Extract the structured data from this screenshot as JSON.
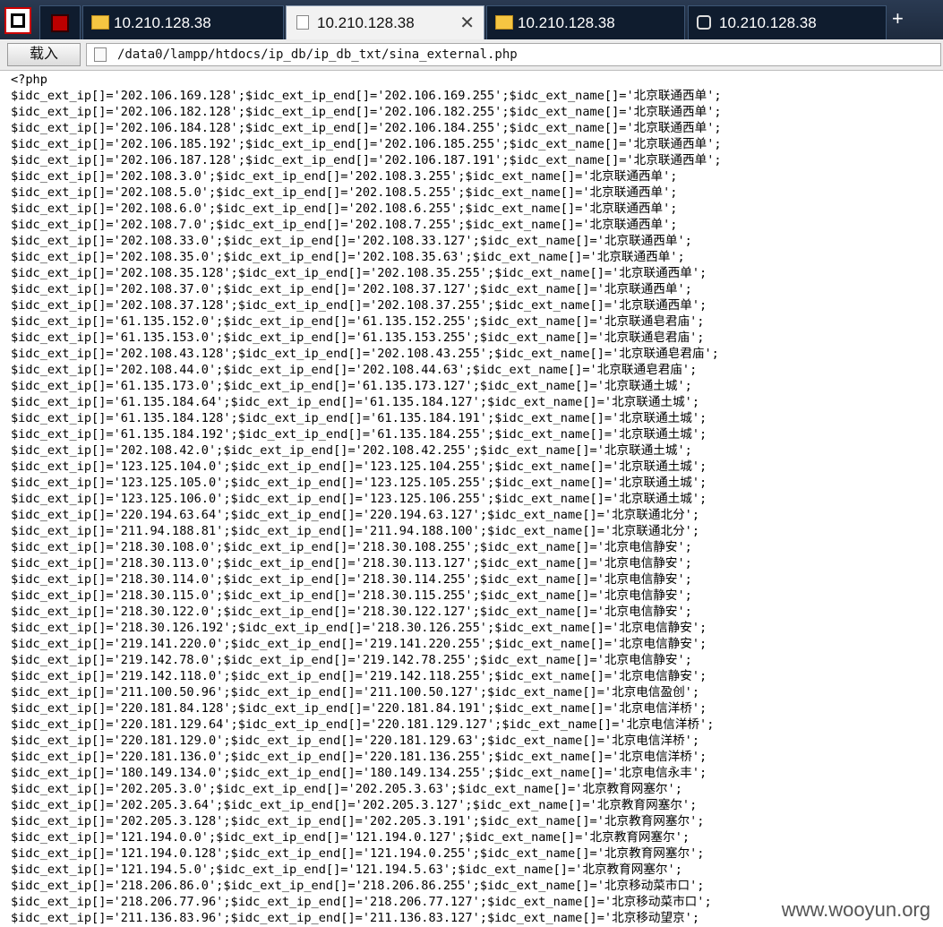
{
  "tabs": [
    {
      "label": "",
      "icon": "red-square-icon"
    },
    {
      "label": "10.210.128.38",
      "icon": "folder-icon"
    },
    {
      "label": "10.210.128.38",
      "icon": "page-icon",
      "active": true
    },
    {
      "label": "10.210.128.38",
      "icon": "folder-icon"
    },
    {
      "label": "10.210.128.38",
      "icon": "database-icon"
    }
  ],
  "tab_close": "✕",
  "new_tab": "+",
  "toolbar": {
    "load_label": "载入",
    "path": "/data0/lampp/htdocs/ip_db/ip_db_txt/sina_external.php"
  },
  "code_lines": [
    "<?php",
    "$idc_ext_ip[]='202.106.169.128';$idc_ext_ip_end[]='202.106.169.255';$idc_ext_name[]='北京联通西单';",
    "$idc_ext_ip[]='202.106.182.128';$idc_ext_ip_end[]='202.106.182.255';$idc_ext_name[]='北京联通西单';",
    "$idc_ext_ip[]='202.106.184.128';$idc_ext_ip_end[]='202.106.184.255';$idc_ext_name[]='北京联通西单';",
    "$idc_ext_ip[]='202.106.185.192';$idc_ext_ip_end[]='202.106.185.255';$idc_ext_name[]='北京联通西单';",
    "$idc_ext_ip[]='202.106.187.128';$idc_ext_ip_end[]='202.106.187.191';$idc_ext_name[]='北京联通西单';",
    "$idc_ext_ip[]='202.108.3.0';$idc_ext_ip_end[]='202.108.3.255';$idc_ext_name[]='北京联通西单';",
    "$idc_ext_ip[]='202.108.5.0';$idc_ext_ip_end[]='202.108.5.255';$idc_ext_name[]='北京联通西单';",
    "$idc_ext_ip[]='202.108.6.0';$idc_ext_ip_end[]='202.108.6.255';$idc_ext_name[]='北京联通西单';",
    "$idc_ext_ip[]='202.108.7.0';$idc_ext_ip_end[]='202.108.7.255';$idc_ext_name[]='北京联通西单';",
    "$idc_ext_ip[]='202.108.33.0';$idc_ext_ip_end[]='202.108.33.127';$idc_ext_name[]='北京联通西单';",
    "$idc_ext_ip[]='202.108.35.0';$idc_ext_ip_end[]='202.108.35.63';$idc_ext_name[]='北京联通西单';",
    "$idc_ext_ip[]='202.108.35.128';$idc_ext_ip_end[]='202.108.35.255';$idc_ext_name[]='北京联通西单';",
    "$idc_ext_ip[]='202.108.37.0';$idc_ext_ip_end[]='202.108.37.127';$idc_ext_name[]='北京联通西单';",
    "$idc_ext_ip[]='202.108.37.128';$idc_ext_ip_end[]='202.108.37.255';$idc_ext_name[]='北京联通西单';",
    "$idc_ext_ip[]='61.135.152.0';$idc_ext_ip_end[]='61.135.152.255';$idc_ext_name[]='北京联通皂君庙';",
    "$idc_ext_ip[]='61.135.153.0';$idc_ext_ip_end[]='61.135.153.255';$idc_ext_name[]='北京联通皂君庙';",
    "$idc_ext_ip[]='202.108.43.128';$idc_ext_ip_end[]='202.108.43.255';$idc_ext_name[]='北京联通皂君庙';",
    "$idc_ext_ip[]='202.108.44.0';$idc_ext_ip_end[]='202.108.44.63';$idc_ext_name[]='北京联通皂君庙';",
    "$idc_ext_ip[]='61.135.173.0';$idc_ext_ip_end[]='61.135.173.127';$idc_ext_name[]='北京联通土城';",
    "$idc_ext_ip[]='61.135.184.64';$idc_ext_ip_end[]='61.135.184.127';$idc_ext_name[]='北京联通土城';",
    "$idc_ext_ip[]='61.135.184.128';$idc_ext_ip_end[]='61.135.184.191';$idc_ext_name[]='北京联通土城';",
    "$idc_ext_ip[]='61.135.184.192';$idc_ext_ip_end[]='61.135.184.255';$idc_ext_name[]='北京联通土城';",
    "$idc_ext_ip[]='202.108.42.0';$idc_ext_ip_end[]='202.108.42.255';$idc_ext_name[]='北京联通土城';",
    "$idc_ext_ip[]='123.125.104.0';$idc_ext_ip_end[]='123.125.104.255';$idc_ext_name[]='北京联通土城';",
    "$idc_ext_ip[]='123.125.105.0';$idc_ext_ip_end[]='123.125.105.255';$idc_ext_name[]='北京联通土城';",
    "$idc_ext_ip[]='123.125.106.0';$idc_ext_ip_end[]='123.125.106.255';$idc_ext_name[]='北京联通土城';",
    "$idc_ext_ip[]='220.194.63.64';$idc_ext_ip_end[]='220.194.63.127';$idc_ext_name[]='北京联通北分';",
    "$idc_ext_ip[]='211.94.188.81';$idc_ext_ip_end[]='211.94.188.100';$idc_ext_name[]='北京联通北分';",
    "$idc_ext_ip[]='218.30.108.0';$idc_ext_ip_end[]='218.30.108.255';$idc_ext_name[]='北京电信静安';",
    "$idc_ext_ip[]='218.30.113.0';$idc_ext_ip_end[]='218.30.113.127';$idc_ext_name[]='北京电信静安';",
    "$idc_ext_ip[]='218.30.114.0';$idc_ext_ip_end[]='218.30.114.255';$idc_ext_name[]='北京电信静安';",
    "$idc_ext_ip[]='218.30.115.0';$idc_ext_ip_end[]='218.30.115.255';$idc_ext_name[]='北京电信静安';",
    "$idc_ext_ip[]='218.30.122.0';$idc_ext_ip_end[]='218.30.122.127';$idc_ext_name[]='北京电信静安';",
    "$idc_ext_ip[]='218.30.126.192';$idc_ext_ip_end[]='218.30.126.255';$idc_ext_name[]='北京电信静安';",
    "$idc_ext_ip[]='219.141.220.0';$idc_ext_ip_end[]='219.141.220.255';$idc_ext_name[]='北京电信静安';",
    "$idc_ext_ip[]='219.142.78.0';$idc_ext_ip_end[]='219.142.78.255';$idc_ext_name[]='北京电信静安';",
    "$idc_ext_ip[]='219.142.118.0';$idc_ext_ip_end[]='219.142.118.255';$idc_ext_name[]='北京电信静安';",
    "$idc_ext_ip[]='211.100.50.96';$idc_ext_ip_end[]='211.100.50.127';$idc_ext_name[]='北京电信盈创';",
    "$idc_ext_ip[]='220.181.84.128';$idc_ext_ip_end[]='220.181.84.191';$idc_ext_name[]='北京电信洋桥';",
    "$idc_ext_ip[]='220.181.129.64';$idc_ext_ip_end[]='220.181.129.127';$idc_ext_name[]='北京电信洋桥';",
    "$idc_ext_ip[]='220.181.129.0';$idc_ext_ip_end[]='220.181.129.63';$idc_ext_name[]='北京电信洋桥';",
    "$idc_ext_ip[]='220.181.136.0';$idc_ext_ip_end[]='220.181.136.255';$idc_ext_name[]='北京电信洋桥';",
    "$idc_ext_ip[]='180.149.134.0';$idc_ext_ip_end[]='180.149.134.255';$idc_ext_name[]='北京电信永丰';",
    "$idc_ext_ip[]='202.205.3.0';$idc_ext_ip_end[]='202.205.3.63';$idc_ext_name[]='北京教育网塞尔';",
    "$idc_ext_ip[]='202.205.3.64';$idc_ext_ip_end[]='202.205.3.127';$idc_ext_name[]='北京教育网塞尔';",
    "$idc_ext_ip[]='202.205.3.128';$idc_ext_ip_end[]='202.205.3.191';$idc_ext_name[]='北京教育网塞尔';",
    "$idc_ext_ip[]='121.194.0.0';$idc_ext_ip_end[]='121.194.0.127';$idc_ext_name[]='北京教育网塞尔';",
    "$idc_ext_ip[]='121.194.0.128';$idc_ext_ip_end[]='121.194.0.255';$idc_ext_name[]='北京教育网塞尔';",
    "$idc_ext_ip[]='121.194.5.0';$idc_ext_ip_end[]='121.194.5.63';$idc_ext_name[]='北京教育网塞尔';",
    "$idc_ext_ip[]='218.206.86.0';$idc_ext_ip_end[]='218.206.86.255';$idc_ext_name[]='北京移动菜市口';",
    "$idc_ext_ip[]='218.206.77.96';$idc_ext_ip_end[]='218.206.77.127';$idc_ext_name[]='北京移动菜市口';",
    "$idc_ext_ip[]='211.136.83.96';$idc_ext_ip_end[]='211.136.83.127';$idc_ext_name[]='北京移动望京';"
  ],
  "watermark": "www.wooyun.org"
}
